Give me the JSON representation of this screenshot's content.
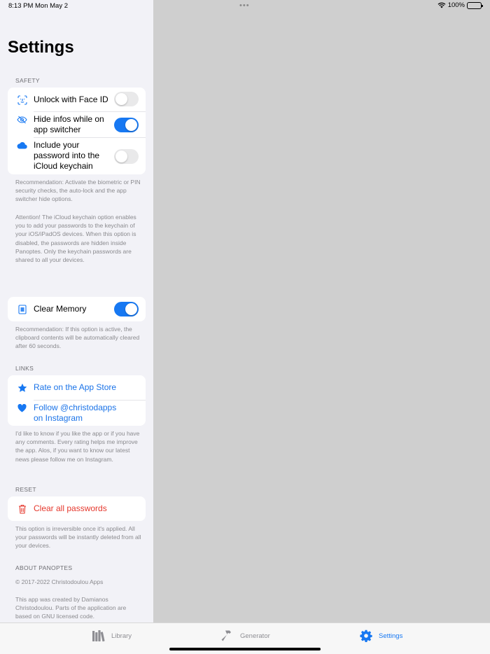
{
  "status": {
    "time": "8:13 PM",
    "date": "Mon May 2",
    "dots": "•••",
    "battery": "100%"
  },
  "title": "Settings",
  "safety": {
    "header": "SAFETY",
    "face_id": "Unlock with Face ID",
    "hide_line1": "Hide infos while on",
    "hide_line2": "app switcher",
    "keychain_line1": "Include your",
    "keychain_line2": "password into the",
    "keychain_line3": "iCloud keychain",
    "note1": "Recommendation: Activate the biometric or PIN security checks, the auto-lock and the app switcher hide options.",
    "note2": "Attention! The iCloud keychain option enables you to add your passwords to the keychain of your iOS/iPadOS devices. When this option is disabled, the passwords are hidden inside Panoptes. Only the keychain passwords are shared to all your devices.",
    "toggles": {
      "face_id": false,
      "hide": true,
      "keychain": false
    }
  },
  "memory": {
    "label": "Clear Memory",
    "toggle": true,
    "note": "Recommendation: If this option is active, the clipboard contents will be automatically cleared after 60 seconds."
  },
  "links": {
    "header": "LINKS",
    "rate": "Rate on the App Store",
    "follow_line1": "Follow @christodapps",
    "follow_line2": "on Instagram",
    "note": "I'd like to know if you like the app or if you have any comments. Every rating helps me improve the app. Alos, if you want to know our latest news please follow me on Instagram."
  },
  "reset": {
    "header": "RESET",
    "clear": "Clear all passwords",
    "note": "This option is irreversible once it's applied. All your passwords will be instantly deleted from all your devices."
  },
  "about": {
    "header": "ABOUT PANOPTES",
    "copyright": "© 2017-2022 Christodoulou Apps",
    "note": "This app was created by Damianos Christodoulou. Parts of the application are based on GNU licensed code."
  },
  "tabs": {
    "library": "Library",
    "generator": "Generator",
    "settings": "Settings"
  },
  "colors": {
    "accent": "#1778f2",
    "destructive": "#e5382d",
    "detail_bg": "#cfcfcf"
  }
}
